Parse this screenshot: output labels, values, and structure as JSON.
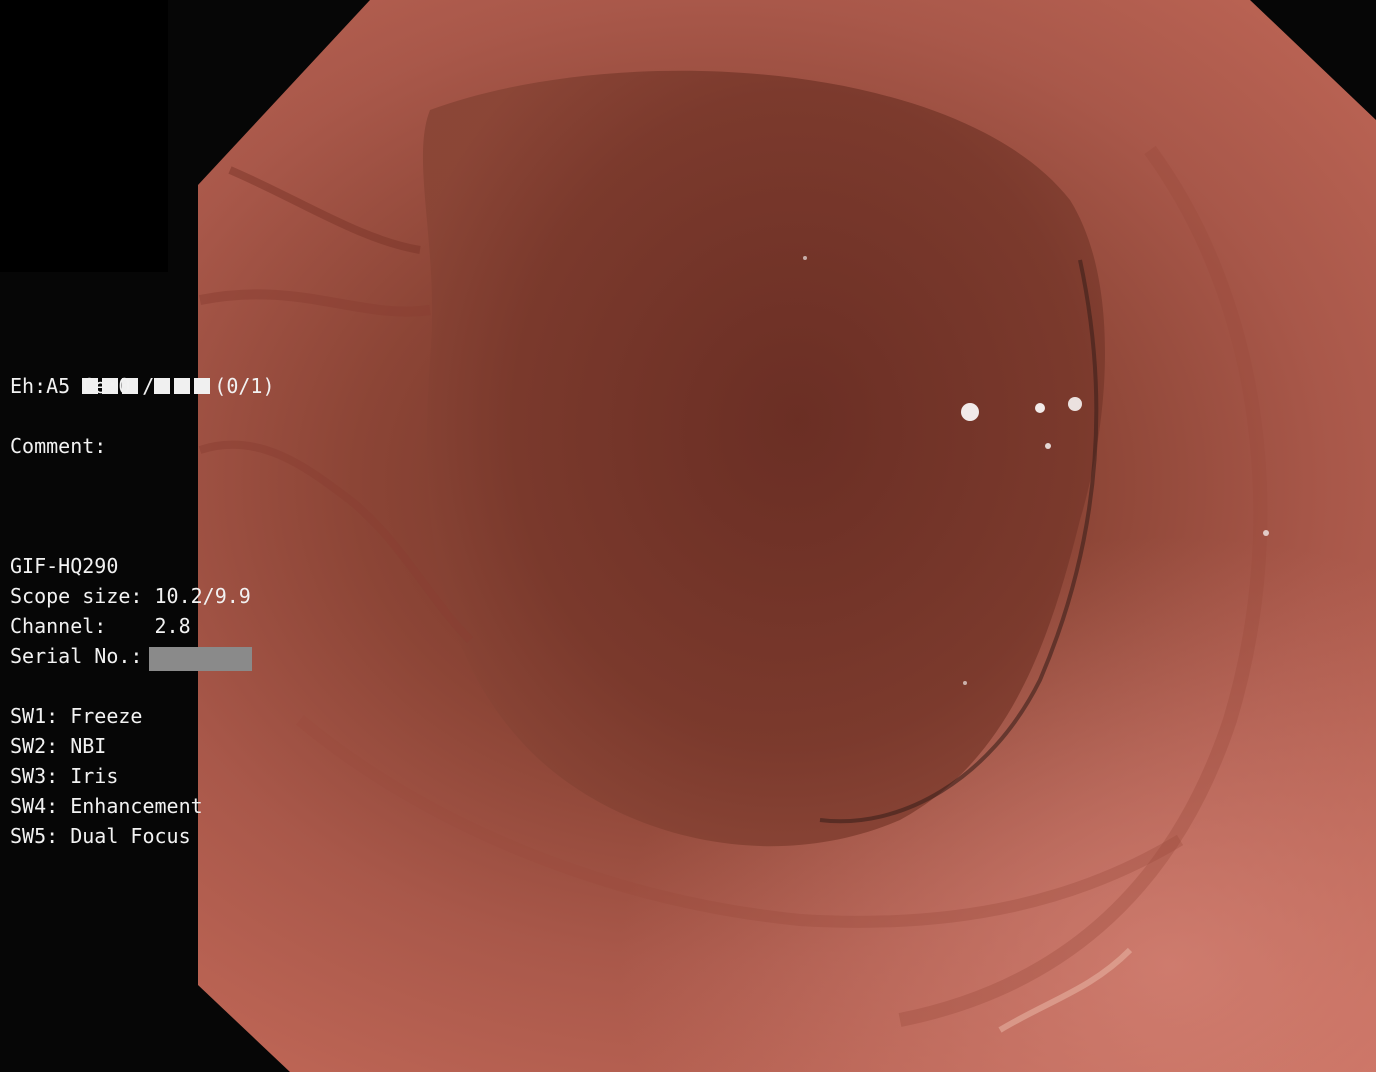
{
  "overlay": {
    "patient_counter": "(0/1)",
    "enhancement": "Eh:A5 Ce:0",
    "comment_label": "Comment:",
    "scope_model": "GIF-HQ290",
    "scope_size": "Scope size: 10.2/9.9",
    "channel": "Channel:    2.8",
    "serial_label": "Serial No.:",
    "switches": [
      "SW1: Freeze",
      "SW2: NBI",
      "SW3: Iris",
      "SW4: Enhancement",
      "SW5: Dual Focus"
    ]
  },
  "colors": {
    "background": "#060606",
    "mucosa": "#b2584a",
    "lumen": "#7a3a30",
    "redaction": "#8a8a8a"
  }
}
